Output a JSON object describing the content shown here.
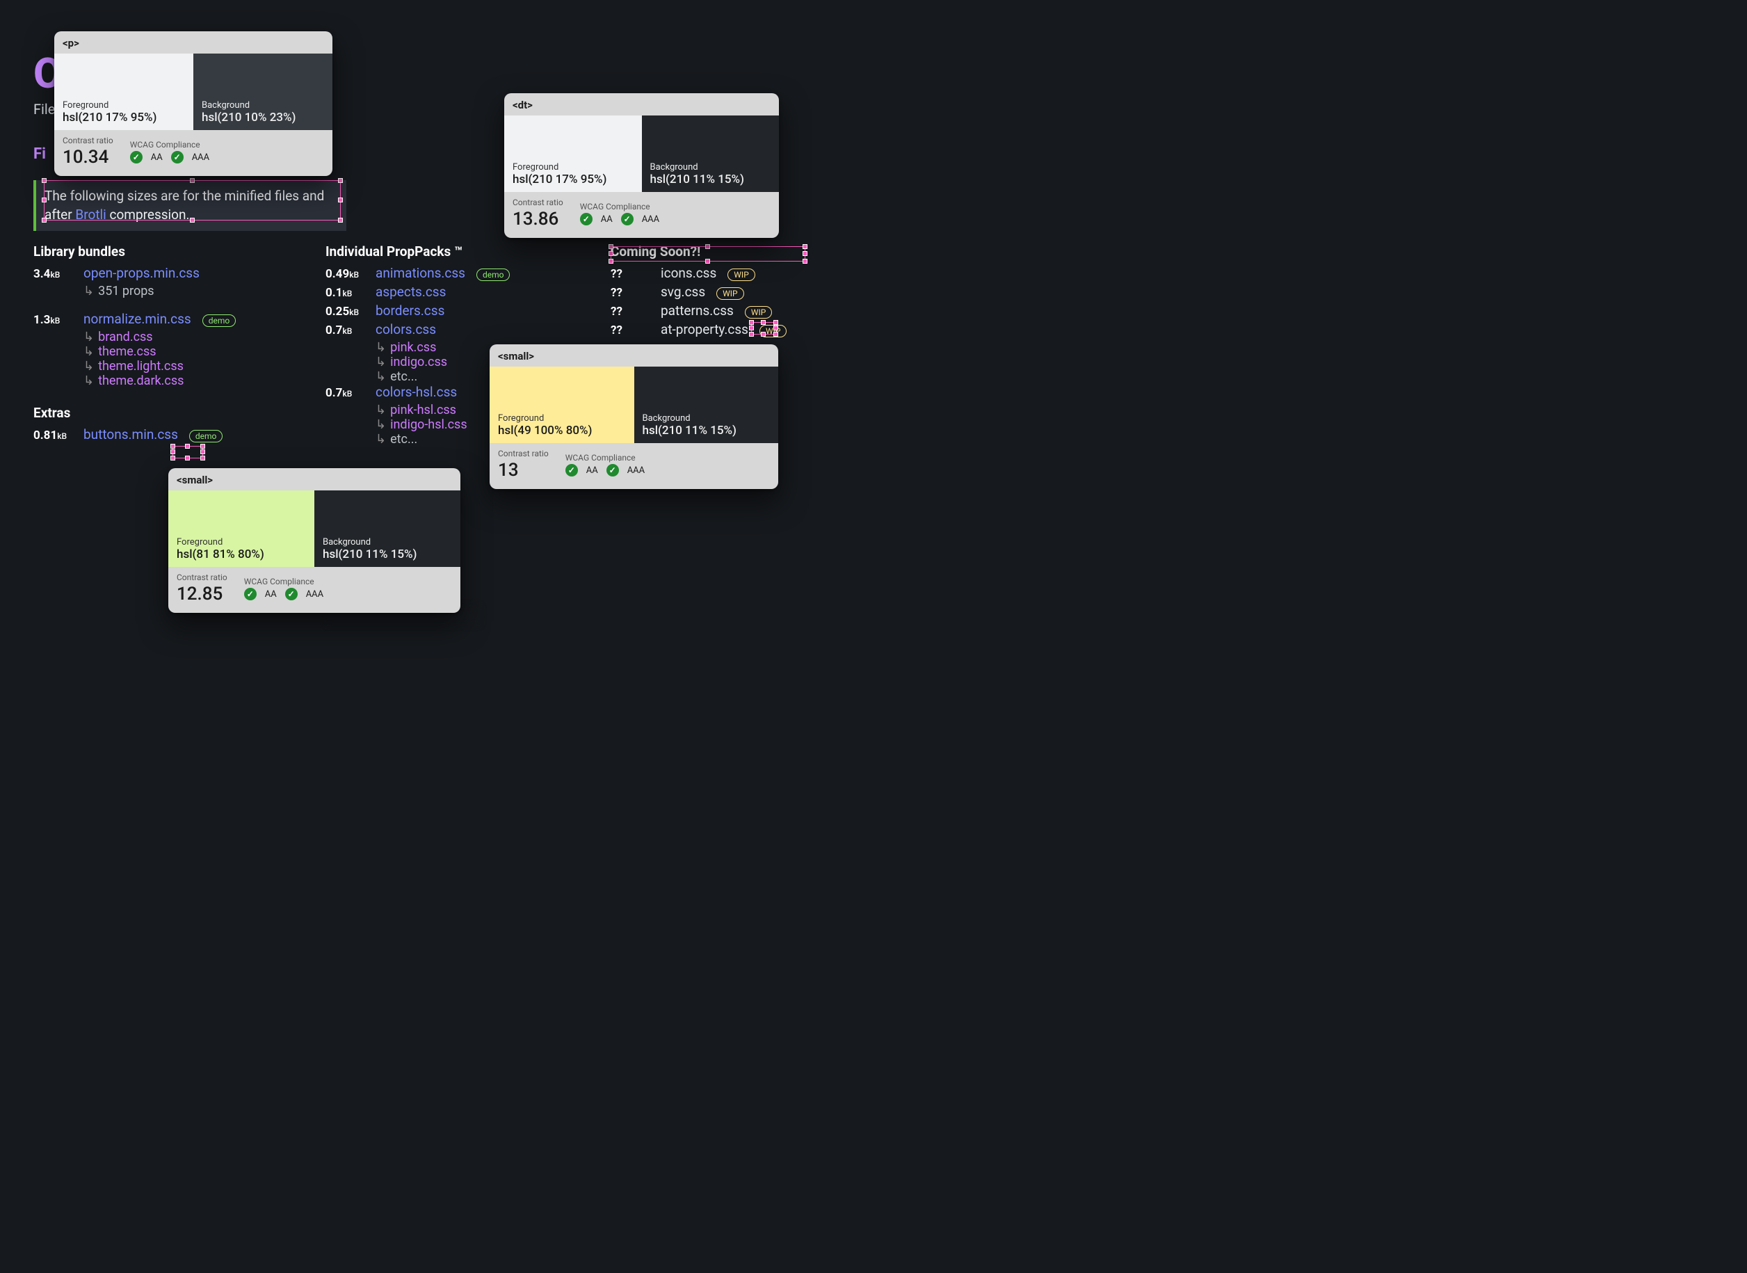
{
  "page": {
    "bigO": "O",
    "subtitle_prefix": "File",
    "fil_header_prefix": "Fi",
    "callout_before": "The following sizes are for the minified files and after ",
    "callout_link": "Brotli",
    "callout_after": " compression."
  },
  "columns": {
    "library": {
      "title": "Library bundles",
      "items": [
        {
          "size": "3.4",
          "unit": "kB",
          "name": "open-props.min.css",
          "subs": [
            {
              "text": "351 props",
              "muted": true
            }
          ]
        },
        {
          "size": "1.3",
          "unit": "kB",
          "name": "normalize.min.css",
          "badge": "demo",
          "subs": [
            {
              "text": "brand.css"
            },
            {
              "text": "theme.css"
            },
            {
              "text": "theme.light.css"
            },
            {
              "text": "theme.dark.css"
            }
          ]
        }
      ],
      "extras_title": "Extras",
      "extras": [
        {
          "size": "0.81",
          "unit": "kB",
          "name": "buttons.min.css",
          "badge": "demo",
          "selected": true
        }
      ]
    },
    "packs": {
      "title": "Individual PropPacks ™",
      "items": [
        {
          "size": "0.49",
          "unit": "kB",
          "name": "animations.css",
          "badge": "demo"
        },
        {
          "size": "0.1",
          "unit": "kB",
          "name": "aspects.css"
        },
        {
          "size": "0.25",
          "unit": "kB",
          "name": "borders.css"
        },
        {
          "size": "0.7",
          "unit": "kB",
          "name": "colors.css",
          "subs": [
            {
              "text": "pink.css"
            },
            {
              "text": "indigo.css"
            },
            {
              "text": "etc...",
              "muted": true
            }
          ]
        },
        {
          "size": "0.7",
          "unit": "kB",
          "name": "colors-hsl.css",
          "subs": [
            {
              "text": "pink-hsl.css"
            },
            {
              "text": "indigo-hsl.css"
            },
            {
              "text": "etc...",
              "muted": true
            }
          ]
        }
      ]
    },
    "coming": {
      "title": "Coming Soon?!",
      "items": [
        {
          "size": "??",
          "name": "icons.css",
          "badge": "WIP"
        },
        {
          "size": "??",
          "name": "svg.css",
          "badge": "WIP"
        },
        {
          "size": "??",
          "name": "patterns.css",
          "badge": "WIP"
        },
        {
          "size": "??",
          "name": "at-property.css",
          "badge": "WIP",
          "selected": true
        }
      ]
    }
  },
  "tips": {
    "p": {
      "tag": "<p>",
      "fg_label": "Foreground",
      "fg": "hsl(210 17% 95%)",
      "fg_color": "hsl(210,17%,95%)",
      "bg_label": "Background",
      "bg": "hsl(210 10% 23%)",
      "bg_color": "hsl(210,10%,23%)",
      "ratio_label": "Contrast ratio",
      "ratio": "10.34",
      "wcag_label": "WCAG Compliance",
      "aa": "AA",
      "aaa": "AAA"
    },
    "dt": {
      "tag": "<dt>",
      "fg_label": "Foreground",
      "fg": "hsl(210 17% 95%)",
      "fg_color": "hsl(210,17%,95%)",
      "bg_label": "Background",
      "bg": "hsl(210 11% 15%)",
      "bg_color": "hsl(210,11%,15%)",
      "ratio_label": "Contrast ratio",
      "ratio": "13.86",
      "wcag_label": "WCAG Compliance",
      "aa": "AA",
      "aaa": "AAA"
    },
    "small_yellow": {
      "tag": "<small>",
      "fg_label": "Foreground",
      "fg": "hsl(49 100% 80%)",
      "fg_color": "hsl(49,100%,80%)",
      "bg_label": "Background",
      "bg": "hsl(210 11% 15%)",
      "bg_color": "hsl(210,11%,15%)",
      "ratio_label": "Contrast ratio",
      "ratio": "13",
      "wcag_label": "WCAG Compliance",
      "aa": "AA",
      "aaa": "AAA"
    },
    "small_green": {
      "tag": "<small>",
      "fg_label": "Foreground",
      "fg": "hsl(81 81% 80%)",
      "fg_color": "hsl(81,81%,80%)",
      "bg_label": "Background",
      "bg": "hsl(210 11% 15%)",
      "bg_color": "hsl(210,11%,15%)",
      "ratio_label": "Contrast ratio",
      "ratio": "12.85",
      "wcag_label": "WCAG Compliance",
      "aa": "AA",
      "aaa": "AAA"
    }
  },
  "arrow_glyph": "↳",
  "check_glyph": "✓"
}
